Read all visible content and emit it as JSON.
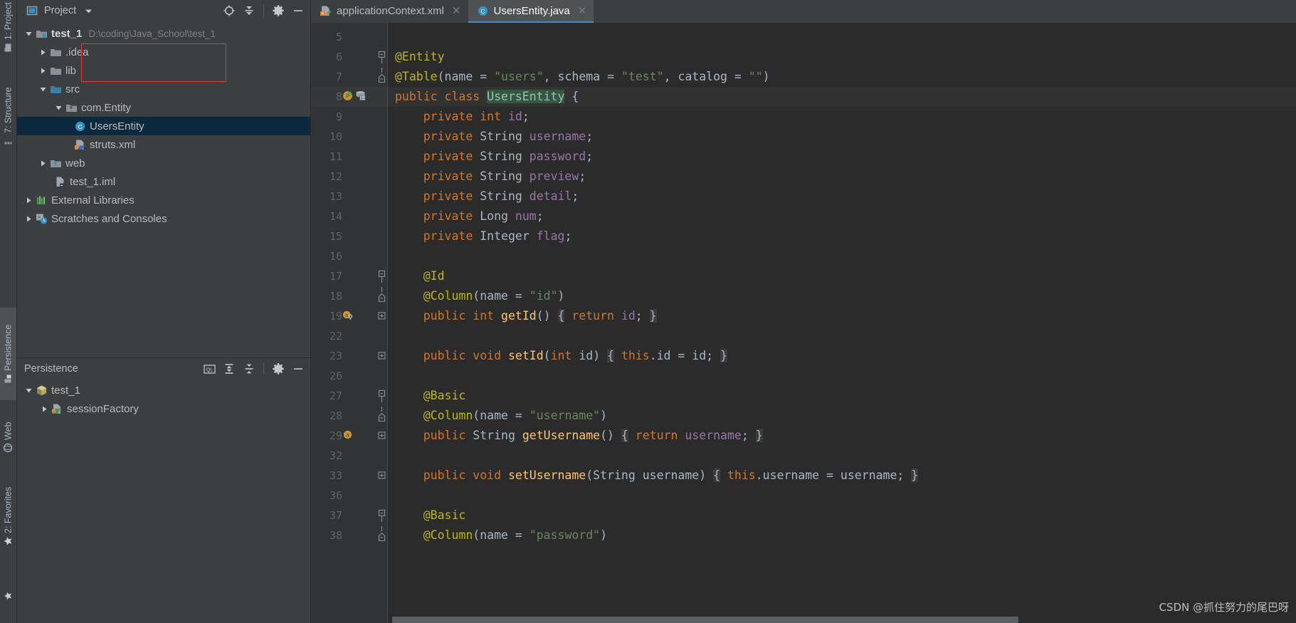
{
  "tool_strip": {
    "tabs": [
      {
        "label": "1: Project",
        "icon": "project-icon",
        "active": false
      },
      {
        "label": "7: Structure",
        "icon": "structure-icon",
        "active": false
      },
      {
        "label": "Persistence",
        "icon": "persistence-icon",
        "active": true
      },
      {
        "label": "Web",
        "icon": "web-globe-icon",
        "active": false
      },
      {
        "label": "2: Favorites",
        "icon": "favorites-star-icon",
        "active": false
      }
    ]
  },
  "project_panel": {
    "title": "Project",
    "dropdown_icon": "chevron-down-icon",
    "view_icon": "project-view-icon",
    "toolbar": [
      {
        "name": "locate-icon",
        "label": "Select Opened File"
      },
      {
        "name": "collapse-all-icon",
        "label": "Collapse All"
      },
      {
        "name": "gear-icon",
        "label": "Settings"
      },
      {
        "name": "minimize-icon",
        "label": "Hide"
      }
    ],
    "tree": [
      {
        "label": "test_1",
        "path": "D:\\coding\\Java_School\\test_1",
        "icon": "module-folder-icon",
        "indent": 0,
        "arrow": "expanded",
        "bold": true,
        "selected": false
      },
      {
        "label": ".idea",
        "path": "",
        "icon": "folder-icon",
        "indent": 1,
        "arrow": "collapsed",
        "bold": false,
        "selected": false
      },
      {
        "label": "lib",
        "path": "",
        "icon": "folder-icon",
        "indent": 1,
        "arrow": "collapsed",
        "bold": false,
        "selected": false
      },
      {
        "label": "src",
        "path": "",
        "icon": "source-root-icon",
        "indent": 1,
        "arrow": "expanded",
        "bold": false,
        "selected": false
      },
      {
        "label": "com.Entity",
        "path": "",
        "icon": "package-icon",
        "indent": 2,
        "arrow": "expanded",
        "bold": false,
        "selected": false
      },
      {
        "label": "UsersEntity",
        "path": "",
        "icon": "java-class-icon",
        "indent": 3,
        "arrow": "none",
        "bold": false,
        "selected": true
      },
      {
        "label": "struts.xml",
        "path": "",
        "icon": "xml-struts-icon",
        "indent": 3,
        "arrow": "none",
        "bold": false,
        "selected": false
      },
      {
        "label": "web",
        "path": "",
        "icon": "web-root-icon",
        "indent": 1,
        "arrow": "collapsed",
        "bold": false,
        "selected": false
      },
      {
        "label": "test_1.iml",
        "path": "",
        "icon": "iml-file-icon",
        "indent": 1,
        "arrow": "none",
        "bold": false,
        "selected": false
      },
      {
        "label": "External Libraries",
        "path": "",
        "icon": "libraries-icon",
        "indent": 0,
        "arrow": "collapsed",
        "bold": false,
        "selected": false
      },
      {
        "label": "Scratches and Consoles",
        "path": "",
        "icon": "scratches-icon",
        "indent": 0,
        "arrow": "collapsed",
        "bold": false,
        "selected": false
      }
    ],
    "highlight_note": "red annotation rectangle around com.Entity / UsersEntity"
  },
  "persistence_panel": {
    "title": "Persistence",
    "toolbar": [
      {
        "name": "ql-console-icon",
        "label": "QL Console"
      },
      {
        "name": "expand-all-icon",
        "label": "Expand All"
      },
      {
        "name": "collapse-all-icon",
        "label": "Collapse All"
      },
      {
        "name": "gear-icon",
        "label": "Settings"
      },
      {
        "name": "minimize-icon",
        "label": "Hide"
      }
    ],
    "tree": [
      {
        "label": "test_1",
        "icon": "persistence-unit-icon",
        "indent": 0,
        "arrow": "expanded"
      },
      {
        "label": "sessionFactory",
        "icon": "session-factory-icon",
        "indent": 1,
        "arrow": "collapsed"
      }
    ]
  },
  "editor": {
    "tabs": [
      {
        "label": "applicationContext.xml",
        "icon": "spring-xml-icon",
        "active": false,
        "closable": true
      },
      {
        "label": "UsersEntity.java",
        "icon": "java-class-icon",
        "active": true,
        "closable": true
      }
    ],
    "lines": [
      {
        "num": "5",
        "gutter": [],
        "fold": "",
        "tokens": [],
        "current": false
      },
      {
        "num": "6",
        "gutter": [],
        "fold": "top",
        "tokens": [
          {
            "t": "@Entity",
            "c": "an"
          }
        ],
        "current": false
      },
      {
        "num": "7",
        "gutter": [],
        "fold": "mid",
        "tokens": [
          {
            "t": "@Table",
            "c": "an"
          },
          {
            "t": "(",
            "c": "pnorm"
          },
          {
            "t": "name",
            "c": "ty"
          },
          {
            "t": " = ",
            "c": "pnorm"
          },
          {
            "t": "\"users\"",
            "c": "st"
          },
          {
            "t": ", ",
            "c": "pnorm"
          },
          {
            "t": "schema",
            "c": "ty"
          },
          {
            "t": " = ",
            "c": "pnorm"
          },
          {
            "t": "\"test\"",
            "c": "st"
          },
          {
            "t": ", ",
            "c": "pnorm"
          },
          {
            "t": "catalog",
            "c": "ty"
          },
          {
            "t": " = ",
            "c": "pnorm"
          },
          {
            "t": "\"\"",
            "c": "st"
          },
          {
            "t": ")",
            "c": "pnorm"
          }
        ],
        "current": false
      },
      {
        "num": "8",
        "gutter": [
          "persistence-bean-icon",
          "database-table-icon"
        ],
        "fold": "",
        "tokens": [
          {
            "t": "public class ",
            "c": "k"
          },
          {
            "t": "UsersEntity",
            "c": "classhl"
          },
          {
            "t": " {",
            "c": "pnorm"
          }
        ],
        "current": true
      },
      {
        "num": "9",
        "gutter": [],
        "fold": "",
        "tokens": [
          {
            "t": "    private int ",
            "c": "k"
          },
          {
            "t": "id",
            "c": "fl"
          },
          {
            "t": ";",
            "c": "pnorm"
          }
        ],
        "current": false
      },
      {
        "num": "10",
        "gutter": [],
        "fold": "",
        "tokens": [
          {
            "t": "    private ",
            "c": "k"
          },
          {
            "t": "String ",
            "c": "ty"
          },
          {
            "t": "username",
            "c": "fl"
          },
          {
            "t": ";",
            "c": "pnorm"
          }
        ],
        "current": false
      },
      {
        "num": "11",
        "gutter": [],
        "fold": "",
        "tokens": [
          {
            "t": "    private ",
            "c": "k"
          },
          {
            "t": "String ",
            "c": "ty"
          },
          {
            "t": "password",
            "c": "fl"
          },
          {
            "t": ";",
            "c": "pnorm"
          }
        ],
        "current": false
      },
      {
        "num": "12",
        "gutter": [],
        "fold": "",
        "tokens": [
          {
            "t": "    private ",
            "c": "k"
          },
          {
            "t": "String ",
            "c": "ty"
          },
          {
            "t": "preview",
            "c": "fl"
          },
          {
            "t": ";",
            "c": "pnorm"
          }
        ],
        "current": false
      },
      {
        "num": "13",
        "gutter": [],
        "fold": "",
        "tokens": [
          {
            "t": "    private ",
            "c": "k"
          },
          {
            "t": "String ",
            "c": "ty"
          },
          {
            "t": "detail",
            "c": "fl"
          },
          {
            "t": ";",
            "c": "pnorm"
          }
        ],
        "current": false
      },
      {
        "num": "14",
        "gutter": [],
        "fold": "",
        "tokens": [
          {
            "t": "    private ",
            "c": "k"
          },
          {
            "t": "Long ",
            "c": "ty"
          },
          {
            "t": "num",
            "c": "fl"
          },
          {
            "t": ";",
            "c": "pnorm"
          }
        ],
        "current": false
      },
      {
        "num": "15",
        "gutter": [],
        "fold": "",
        "tokens": [
          {
            "t": "    private ",
            "c": "k"
          },
          {
            "t": "Integer ",
            "c": "ty"
          },
          {
            "t": "flag",
            "c": "fl"
          },
          {
            "t": ";",
            "c": "pnorm"
          }
        ],
        "current": false
      },
      {
        "num": "16",
        "gutter": [],
        "fold": "",
        "tokens": [],
        "current": false
      },
      {
        "num": "17",
        "gutter": [],
        "fold": "top",
        "tokens": [
          {
            "t": "    @Id",
            "c": "an"
          }
        ],
        "current": false
      },
      {
        "num": "18",
        "gutter": [],
        "fold": "mid",
        "tokens": [
          {
            "t": "    @Column",
            "c": "an"
          },
          {
            "t": "(",
            "c": "pnorm"
          },
          {
            "t": "name",
            "c": "ty"
          },
          {
            "t": " = ",
            "c": "pnorm"
          },
          {
            "t": "\"id\"",
            "c": "st"
          },
          {
            "t": ")",
            "c": "pnorm"
          }
        ],
        "current": false
      },
      {
        "num": "19",
        "gutter": [
          "attribute-key-icon"
        ],
        "fold": "plus",
        "tokens": [
          {
            "t": "    public int ",
            "c": "k"
          },
          {
            "t": "getId",
            "c": "mth"
          },
          {
            "t": "() ",
            "c": "pnorm"
          },
          {
            "t": "{",
            "c": "brc"
          },
          {
            "t": " ",
            "c": "pnorm"
          },
          {
            "t": "return ",
            "c": "k"
          },
          {
            "t": "id",
            "c": "fl"
          },
          {
            "t": "; ",
            "c": "pnorm"
          },
          {
            "t": "}",
            "c": "brc"
          }
        ],
        "current": false
      },
      {
        "num": "22",
        "gutter": [],
        "fold": "",
        "tokens": [],
        "current": false
      },
      {
        "num": "23",
        "gutter": [],
        "fold": "plus",
        "tokens": [
          {
            "t": "    public void ",
            "c": "k"
          },
          {
            "t": "setId",
            "c": "mth"
          },
          {
            "t": "(",
            "c": "pnorm"
          },
          {
            "t": "int ",
            "c": "k"
          },
          {
            "t": "id",
            "c": "pm"
          },
          {
            "t": ") ",
            "c": "pnorm"
          },
          {
            "t": "{",
            "c": "brc"
          },
          {
            "t": " ",
            "c": "pnorm"
          },
          {
            "t": "this",
            "c": "k"
          },
          {
            "t": ".id = ",
            "c": "pnorm"
          },
          {
            "t": "id",
            "c": "pm"
          },
          {
            "t": "; ",
            "c": "pnorm"
          },
          {
            "t": "}",
            "c": "brc"
          }
        ],
        "current": false
      },
      {
        "num": "26",
        "gutter": [],
        "fold": "",
        "tokens": [],
        "current": false
      },
      {
        "num": "27",
        "gutter": [],
        "fold": "top",
        "tokens": [
          {
            "t": "    @Basic",
            "c": "an"
          }
        ],
        "current": false
      },
      {
        "num": "28",
        "gutter": [],
        "fold": "mid",
        "tokens": [
          {
            "t": "    @Column",
            "c": "an"
          },
          {
            "t": "(",
            "c": "pnorm"
          },
          {
            "t": "name",
            "c": "ty"
          },
          {
            "t": " = ",
            "c": "pnorm"
          },
          {
            "t": "\"username\"",
            "c": "st"
          },
          {
            "t": ")",
            "c": "pnorm"
          }
        ],
        "current": false
      },
      {
        "num": "29",
        "gutter": [
          "attribute-icon"
        ],
        "fold": "plus",
        "tokens": [
          {
            "t": "    public ",
            "c": "k"
          },
          {
            "t": "String ",
            "c": "ty"
          },
          {
            "t": "getUsername",
            "c": "mth"
          },
          {
            "t": "() ",
            "c": "pnorm"
          },
          {
            "t": "{",
            "c": "brc"
          },
          {
            "t": " ",
            "c": "pnorm"
          },
          {
            "t": "return ",
            "c": "k"
          },
          {
            "t": "username",
            "c": "fl"
          },
          {
            "t": "; ",
            "c": "pnorm"
          },
          {
            "t": "}",
            "c": "brc"
          }
        ],
        "current": false
      },
      {
        "num": "32",
        "gutter": [],
        "fold": "",
        "tokens": [],
        "current": false
      },
      {
        "num": "33",
        "gutter": [],
        "fold": "plus",
        "tokens": [
          {
            "t": "    public void ",
            "c": "k"
          },
          {
            "t": "setUsername",
            "c": "mth"
          },
          {
            "t": "(",
            "c": "pnorm"
          },
          {
            "t": "String ",
            "c": "ty"
          },
          {
            "t": "username",
            "c": "pm"
          },
          {
            "t": ") ",
            "c": "pnorm"
          },
          {
            "t": "{",
            "c": "brc"
          },
          {
            "t": " ",
            "c": "pnorm"
          },
          {
            "t": "this",
            "c": "k"
          },
          {
            "t": ".username = ",
            "c": "pnorm"
          },
          {
            "t": "username",
            "c": "pm"
          },
          {
            "t": "; ",
            "c": "pnorm"
          },
          {
            "t": "}",
            "c": "brc"
          }
        ],
        "current": false
      },
      {
        "num": "36",
        "gutter": [],
        "fold": "",
        "tokens": [],
        "current": false
      },
      {
        "num": "37",
        "gutter": [],
        "fold": "top",
        "tokens": [
          {
            "t": "    @Basic",
            "c": "an"
          }
        ],
        "current": false
      },
      {
        "num": "38",
        "gutter": [],
        "fold": "mid",
        "tokens": [
          {
            "t": "    @Column",
            "c": "an"
          },
          {
            "t": "(",
            "c": "pnorm"
          },
          {
            "t": "name",
            "c": "ty"
          },
          {
            "t": " = ",
            "c": "pnorm"
          },
          {
            "t": "\"password\"",
            "c": "st"
          },
          {
            "t": ")",
            "c": "pnorm"
          }
        ],
        "current": false
      }
    ]
  },
  "watermark": {
    "text": "CSDN @抓住努力的尾巴呀"
  },
  "colors": {
    "background": "#3c3f41",
    "editor_background": "#2b2b2b",
    "gutter_background": "#313335",
    "selection": "#0d293e",
    "accent_blue": "#4a88c7",
    "annotation_red": "#e03a3a",
    "keyword_orange": "#cc7832",
    "string_green": "#6a8759",
    "annotation_yellow": "#bbb529",
    "field_purple": "#9876aa",
    "method_gold": "#ffc66d",
    "text": "#a9b7c6"
  }
}
